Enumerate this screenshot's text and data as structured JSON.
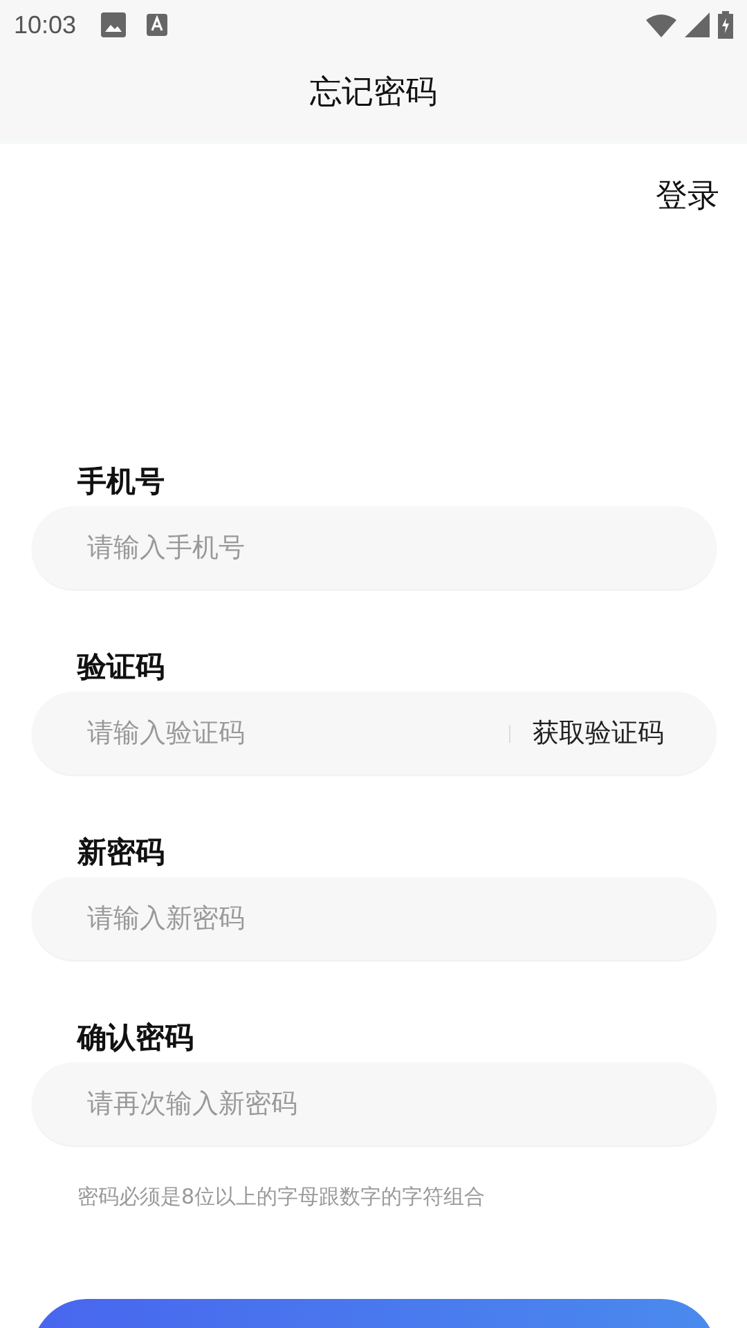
{
  "status_bar": {
    "time": "10:03"
  },
  "header": {
    "title": "忘记密码"
  },
  "login_link": "登录",
  "fields": [
    {
      "kind": "text",
      "label": "手机号",
      "placeholder": "请输入手机号"
    },
    {
      "kind": "code",
      "label": "验证码",
      "placeholder": "请输入验证码",
      "action": "获取验证码"
    },
    {
      "kind": "text",
      "label": "新密码",
      "placeholder": "请输入新密码"
    },
    {
      "kind": "text",
      "label": "确认密码",
      "placeholder": "请再次输入新密码"
    }
  ],
  "hint": "密码必须是8位以上的字母跟数字的字符组合",
  "submit_button": {
    "kind": "button"
  }
}
